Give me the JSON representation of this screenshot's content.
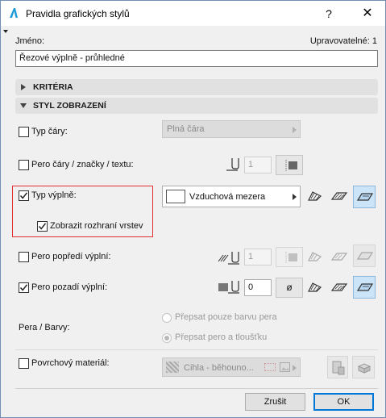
{
  "window": {
    "title": "Pravidla grafických stylů",
    "help_label": "?",
    "close_label": "✕"
  },
  "name_label": "Jméno:",
  "editable_label": "Upravovatelné: 1",
  "name_value": "Řezové výplně - průhledné",
  "sections": {
    "criteria": "KRITÉRIA",
    "display_style": "STYL ZOBRAZENÍ"
  },
  "rows": {
    "line_type": {
      "label": "Typ čáry:",
      "value": "Plná čára",
      "checked": false
    },
    "pen_line": {
      "label": "Pero čáry / značky / textu:",
      "value": "1",
      "checked": false
    },
    "fill_type": {
      "label": "Typ výplně:",
      "value": "Vzduchová mezera",
      "checked": true
    },
    "show_layers": {
      "label": "Zobrazit rozhraní vrstev",
      "checked": true
    },
    "fg_pen": {
      "label": "Pero popředí výplní:",
      "value": "1",
      "checked": false
    },
    "bg_pen": {
      "label": "Pero pozadí výplní:",
      "value": "0",
      "checked": true
    },
    "pen_colors": {
      "label": "Pera / Barvy:",
      "option1": "Přepsat pouze barvu pera",
      "option2": "Přepsat pero a tloušťku"
    },
    "surface": {
      "label": "Povrchový materiál:",
      "value": "Cihla - běhouno...",
      "checked": false
    }
  },
  "buttons": {
    "cancel": "Zrušit",
    "ok": "OK"
  },
  "colors": {
    "highlight": "#e03030",
    "selected_bg": "#cce4f7",
    "accent": "#0078d7"
  }
}
